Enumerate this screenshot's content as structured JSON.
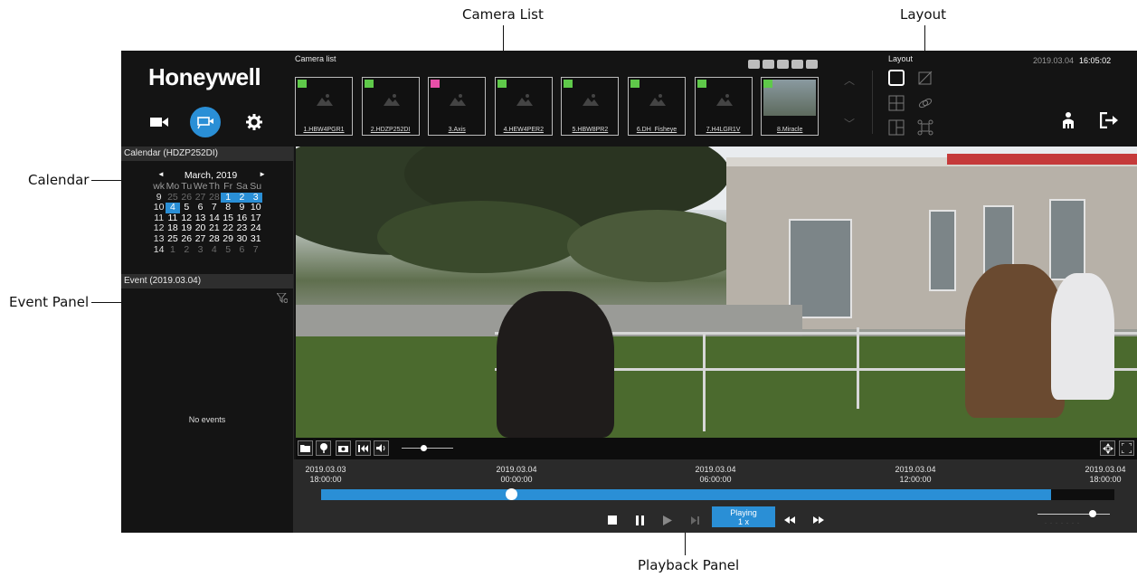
{
  "callouts": {
    "camera_list": "Camera List",
    "layout": "Layout",
    "calendar": "Calendar",
    "event_panel": "Event Panel",
    "playback_panel": "Playback Panel"
  },
  "app": {
    "logo": "Honeywell",
    "mode_icons": [
      "live-camera-icon",
      "playback-camera-icon",
      "gear-icon"
    ],
    "active_mode": "playback",
    "accent": "#2a8fd6"
  },
  "calendar": {
    "header": "Calendar (HDZP252DI)",
    "month": "March, 2019",
    "prev": "◄",
    "next": "►",
    "weekday_header": [
      "wk",
      "Mo",
      "Tu",
      "We",
      "Th",
      "Fr",
      "Sa",
      "Su"
    ],
    "weeks": [
      {
        "wk": "9",
        "days": [
          "25",
          "26",
          "27",
          "28",
          "1",
          "2",
          "3"
        ]
      },
      {
        "wk": "10",
        "days": [
          "4",
          "5",
          "6",
          "7",
          "8",
          "9",
          "10"
        ]
      },
      {
        "wk": "11",
        "days": [
          "11",
          "12",
          "13",
          "14",
          "15",
          "16",
          "17"
        ]
      },
      {
        "wk": "12",
        "days": [
          "18",
          "19",
          "20",
          "21",
          "22",
          "23",
          "24"
        ]
      },
      {
        "wk": "13",
        "days": [
          "25",
          "26",
          "27",
          "28",
          "29",
          "30",
          "31"
        ]
      },
      {
        "wk": "14",
        "days": [
          "1",
          "2",
          "3",
          "4",
          "5",
          "6",
          "7"
        ]
      }
    ],
    "selected_day": "4"
  },
  "events": {
    "header": "Event (2019.03.04)",
    "empty_text": "No events"
  },
  "camera_list": {
    "label": "Camera list",
    "cameras": [
      {
        "name": "1.HBW4PGR1",
        "status": "green"
      },
      {
        "name": "2.HDZP252DI",
        "status": "green"
      },
      {
        "name": "3.Axis",
        "status": "pink"
      },
      {
        "name": "4.HEW4PER2",
        "status": "green"
      },
      {
        "name": "5.HBW8PR2",
        "status": "green"
      },
      {
        "name": "6.DH_Fisheye",
        "status": "green"
      },
      {
        "name": "7.H4LGR1V",
        "status": "green"
      },
      {
        "name": "8.Miracle",
        "status": "green"
      }
    ]
  },
  "layout": {
    "label": "Layout",
    "date": "2019.03.04",
    "time": "16:05:02"
  },
  "playback": {
    "ticks": [
      {
        "date": "2019.03.03",
        "time": "18:00:00"
      },
      {
        "date": "2019.03.04",
        "time": "00:00:00"
      },
      {
        "date": "2019.03.04",
        "time": "06:00:00"
      },
      {
        "date": "2019.03.04",
        "time": "12:00:00"
      },
      {
        "date": "2019.03.04",
        "time": "18:00:00"
      }
    ],
    "state": "Playing",
    "speed": "1 x",
    "recorded_fraction": 0.92,
    "position_fraction": 0.24
  }
}
